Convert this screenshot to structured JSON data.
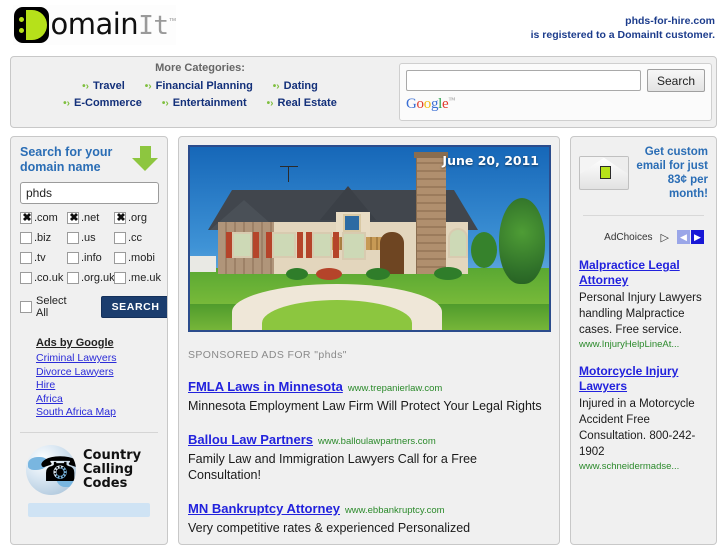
{
  "header": {
    "logo": {
      "part_black": "omain",
      "part_gray": "It",
      "tm": "™"
    },
    "registration": {
      "domain": "phds-for-hire.com",
      "line2": "is registered to a DomainIt customer."
    }
  },
  "categories": {
    "title": "More Categories:",
    "rows": [
      [
        {
          "label": "Travel",
          "bullet": "•›"
        },
        {
          "label": "Financial Planning",
          "bullet": "•›"
        },
        {
          "label": "Dating",
          "bullet": "•›"
        }
      ],
      [
        {
          "label": "E-Commerce",
          "bullet": "•›"
        },
        {
          "label": "Entertainment",
          "bullet": "•›"
        },
        {
          "label": "Real Estate",
          "bullet": "•›"
        }
      ]
    ]
  },
  "web_search": {
    "value": "",
    "placeholder": "",
    "button_label": "Search",
    "provider": {
      "g1": "G",
      "o1": "o",
      "o2": "o",
      "g2": "g",
      "l": "l",
      "e": "e",
      "tm": "™"
    }
  },
  "domain_search": {
    "title": "Search for your domain name",
    "arrow_icon": "arrow-down-green",
    "input_value": "phds",
    "input_placeholder": "",
    "tlds": [
      {
        "label": ".com",
        "checked": true
      },
      {
        "label": ".net",
        "checked": true
      },
      {
        "label": ".org",
        "checked": true
      },
      {
        "label": ".biz",
        "checked": false
      },
      {
        "label": ".us",
        "checked": false
      },
      {
        "label": ".cc",
        "checked": false
      },
      {
        "label": ".tv",
        "checked": false
      },
      {
        "label": ".info",
        "checked": false
      },
      {
        "label": ".mobi",
        "checked": false
      },
      {
        "label": ".co.uk",
        "checked": false
      },
      {
        "label": ".org.uk",
        "checked": false
      },
      {
        "label": ".me.uk",
        "checked": false
      }
    ],
    "select_all_label": "Select All",
    "select_all_checked": false,
    "button_label": "SEARCH"
  },
  "ads_by_google": {
    "title": "Ads by Google",
    "links": [
      "Criminal Lawyers",
      "Divorce Lawyers",
      "Hire",
      "Africa",
      "South Africa Map"
    ]
  },
  "country_calling_codes": {
    "line1": "Country",
    "line2": "Calling",
    "line3": "Codes",
    "icon": "globe-phone-icon"
  },
  "photo": {
    "date": "June 20, 2011",
    "alt": "suburban-house-photo"
  },
  "sponsored": {
    "label": "SPONSORED ADS FOR \"phds\"",
    "ads": [
      {
        "title": "FMLA Laws in Minnesota",
        "url": "www.trepanierlaw.com",
        "desc": "Minnesota Employment Law Firm Will Protect Your Legal Rights"
      },
      {
        "title": "Ballou Law Partners",
        "url": "www.balloulawpartners.com",
        "desc": "Family Law and Immigration Lawyers Call for a Free Consultation!"
      },
      {
        "title": "MN Bankruptcy Attorney",
        "url": "www.ebbankruptcy.com",
        "desc": "Very competitive rates & experienced Personalized"
      }
    ]
  },
  "right_rail": {
    "email_promo": {
      "icon": "envelope-icon",
      "text": "Get custom email for just 83¢ per month!"
    },
    "adchoices": {
      "label": "AdChoices",
      "triangle": "▷",
      "prev": "◀",
      "next": "▶"
    },
    "ads": [
      {
        "title": "Malpractice Legal Attorney",
        "desc": "Personal Injury Lawyers handling Malpractice cases. Free service.",
        "url": "www.InjuryHelpLineAt..."
      },
      {
        "title": "Motorcycle Injury Lawyers",
        "desc": "Injured in a Motorcycle Accident Free Consultation. 800-242-1902",
        "url": "www.schneidermadse..."
      }
    ]
  },
  "colors": {
    "brand_navy": "#1c3c8c",
    "brand_green": "#8dc63f",
    "link_blue": "#2222dd",
    "url_green": "#2b8a2b",
    "panel_bg": "#f0f0f0"
  }
}
